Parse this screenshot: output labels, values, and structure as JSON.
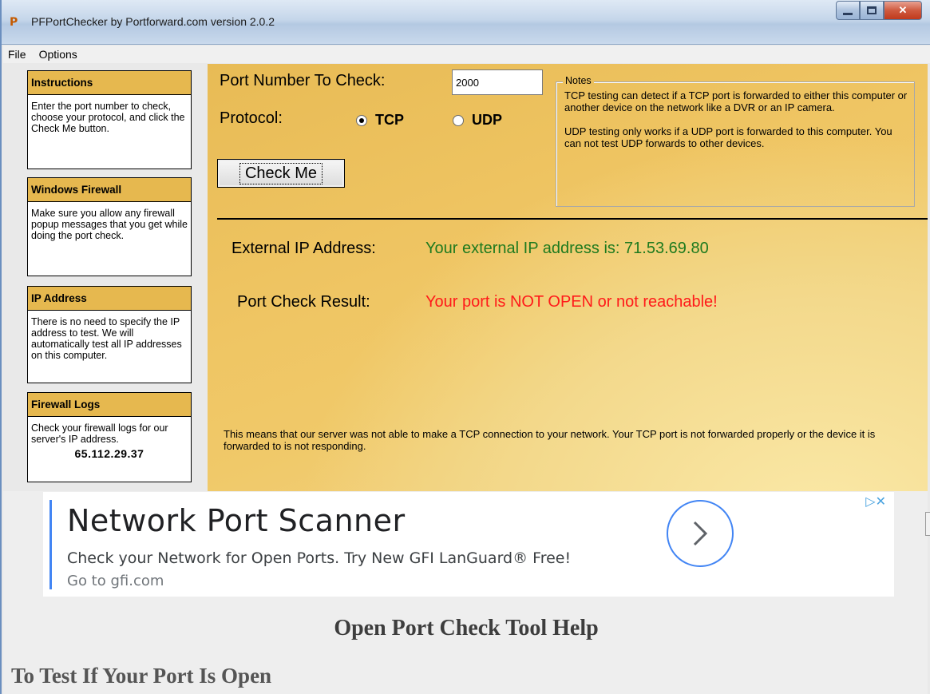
{
  "window": {
    "title": "PFPortChecker by Portforward.com version 2.0.2",
    "icon": "app-logo-icon",
    "app_icon_text": "P"
  },
  "menu": [
    "File",
    "Options"
  ],
  "sidebar": [
    {
      "title": "Instructions",
      "body": "Enter the port number to check, choose your protocol, and click the Check Me button."
    },
    {
      "title": "Windows Firewall",
      "body": "Make sure you allow any firewall popup messages that you get while doing the port check."
    },
    {
      "title": "IP Address",
      "body": "There is no need to specify the IP address to test. We will automatically test all IP addresses on this computer."
    },
    {
      "title": "Firewall Logs",
      "body": "Check your firewall logs for our server's IP address.",
      "ip": "65.112.29.37"
    }
  ],
  "form": {
    "port_label": "Port Number To Check:",
    "port_value": "2000",
    "protocol_label": "Protocol:",
    "protocol_tcp": "TCP",
    "protocol_udp": "UDP",
    "selected_protocol": "TCP",
    "check_button": "Check Me"
  },
  "notes": {
    "legend": "Notes",
    "tcp": "TCP testing can detect if a TCP port is forwarded to either this computer or another device on the network like a DVR or an IP camera.",
    "udp": "UDP testing only works if a UDP port is forwarded to this computer. You can not test UDP forwards to other devices."
  },
  "results": {
    "external_label": "External IP Address:",
    "external_value": "Your external IP address is: 71.53.69.80",
    "result_label": "Port Check Result:",
    "result_value": "Your port is NOT OPEN or not reachable!",
    "explanation": "This means that our server was not able to make a TCP connection to your network. Your TCP port is not forwarded properly or the device it is forwarded to is not responding."
  },
  "ad": {
    "title": "Network Port Scanner",
    "description": "Check your Network for Open Ports. Try New GFI LanGuard® Free!",
    "url": "Go to gfi.com",
    "choices_text": "▷✕"
  },
  "help": {
    "title": "Open Port Check Tool Help",
    "subtitle": "To Test If Your Port Is Open"
  },
  "colors": {
    "panel_gold": "#efc563",
    "sidebar_header": "#e6b84f",
    "external_ip_green": "#1e7a1e",
    "result_red": "#ff1a1a"
  }
}
